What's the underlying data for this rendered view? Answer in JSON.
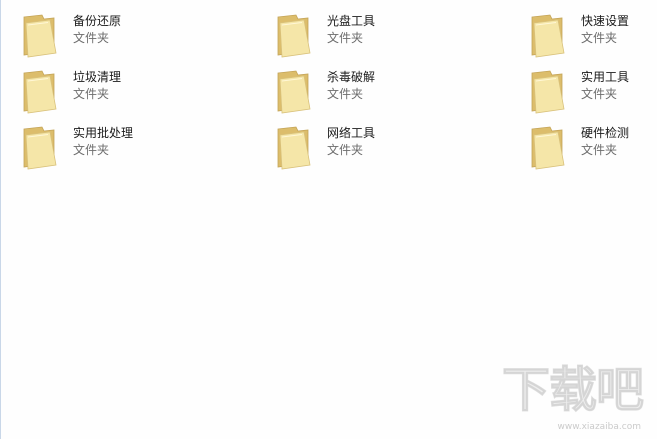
{
  "folder_icon": "folder-icon",
  "folders": [
    {
      "name": "备份还原",
      "type": "文件夹"
    },
    {
      "name": "光盘工具",
      "type": "文件夹"
    },
    {
      "name": "快速设置",
      "type": "文件夹"
    },
    {
      "name": "垃圾清理",
      "type": "文件夹"
    },
    {
      "name": "杀毒破解",
      "type": "文件夹"
    },
    {
      "name": "实用工具",
      "type": "文件夹"
    },
    {
      "name": "实用批处理",
      "type": "文件夹"
    },
    {
      "name": "网络工具",
      "type": "文件夹"
    },
    {
      "name": "硬件检测",
      "type": "文件夹"
    }
  ],
  "watermark": {
    "logo_text": "下载吧",
    "url": "www.xiazaiba.com"
  },
  "colors": {
    "folder_back": "#e3c77a",
    "folder_front": "#f7e8ae",
    "background": "#fefefe"
  }
}
